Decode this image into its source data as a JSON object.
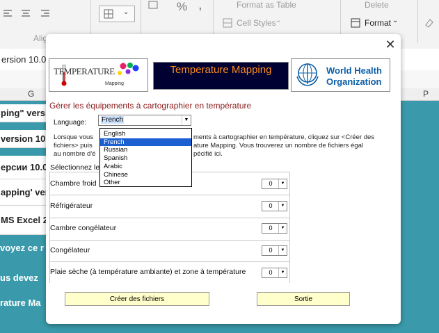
{
  "ribbon": {
    "format_as_table": "Format as Table",
    "cell_styles": "Cell Styles",
    "delete": "Delete",
    "format": "Format",
    "align_group": "Alig",
    "percent": "%"
  },
  "sheet": {
    "title_strip": "ersion 10.0",
    "col_g": "G",
    "col_p": "P",
    "left_rows": [
      "ping\" version",
      "version 10.0",
      "ерсии 10.0",
      "apping' ver",
      "MS Excel 2"
    ],
    "teal_rows": [
      "voyez ce r",
      "us devez",
      "rature Ma"
    ]
  },
  "dialog": {
    "close": "✕",
    "logo_temp": "TEMPERATURE",
    "logo_temp_sub": "Mapping",
    "title": "Temperature Mapping",
    "who_line1": "World Health",
    "who_line2": "Organization",
    "heading": "Gérer les équipements à cartographier en température",
    "language_label": "Language:",
    "language_value": "French",
    "language_options": [
      "English",
      "French",
      "Russian",
      "Spanish",
      "Arabic",
      "Chinese",
      "Other"
    ],
    "para_left": [
      "Lorsque vous",
      "fichiers> puis",
      "au nombre d'é"
    ],
    "para_right": [
      "ments à cartographier en température, cliquez sur <Créer des",
      "ature Mapping.  Vous trouverez un nombre de fichiers égal",
      "pécifié ici."
    ],
    "select_label": "Sélectionnez le",
    "equipment": [
      {
        "label": "Chambre froid",
        "value": "0"
      },
      {
        "label": "Réfrigérateur",
        "value": "0"
      },
      {
        "label": "Cambre congélateur",
        "value": "0"
      },
      {
        "label": "Congélateur",
        "value": "0"
      },
      {
        "label": "Plaie sèche (à température ambiante) et zone à température",
        "value": "0"
      }
    ],
    "create_button": "Créer des fichiers",
    "exit_button": "Sortie"
  }
}
